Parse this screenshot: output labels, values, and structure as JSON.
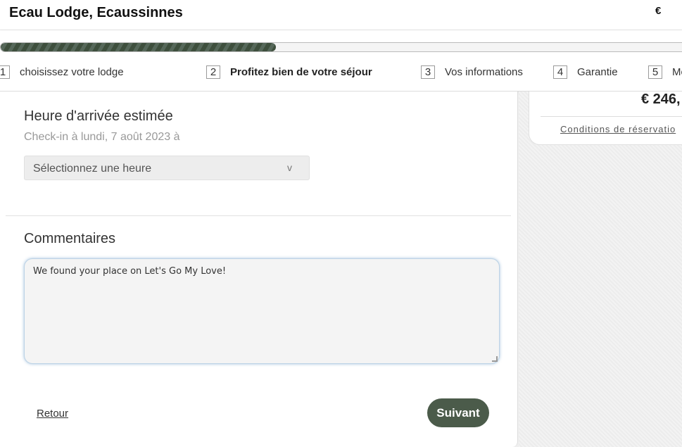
{
  "header": {
    "title": "Ecau Lodge, Ecaussinnes",
    "currency": "€"
  },
  "progress": {
    "fraction": 0.4
  },
  "steps": [
    {
      "num": "1",
      "label": "choisissez votre lodge"
    },
    {
      "num": "2",
      "label": "Profitez bien de votre séjour"
    },
    {
      "num": "3",
      "label": "Vos informations"
    },
    {
      "num": "4",
      "label": "Garantie"
    },
    {
      "num": "5",
      "label": "Mo"
    }
  ],
  "summary": {
    "price": "€ 246,",
    "conditions": "Conditions de réservatio"
  },
  "arrival": {
    "title": "Heure d'arrivée estimée",
    "subtitle": "Check-in à lundi, 7 août 2023 à",
    "select_value": "Sélectionnez une heure",
    "select_chevron": "v"
  },
  "comments": {
    "title": "Commentaires",
    "value": "We found your place on Let's Go My Love!"
  },
  "actions": {
    "back": "Retour",
    "next": "Suivant"
  },
  "colors": {
    "accent": "#4b5b4a",
    "progress": "#3e4f3d"
  }
}
